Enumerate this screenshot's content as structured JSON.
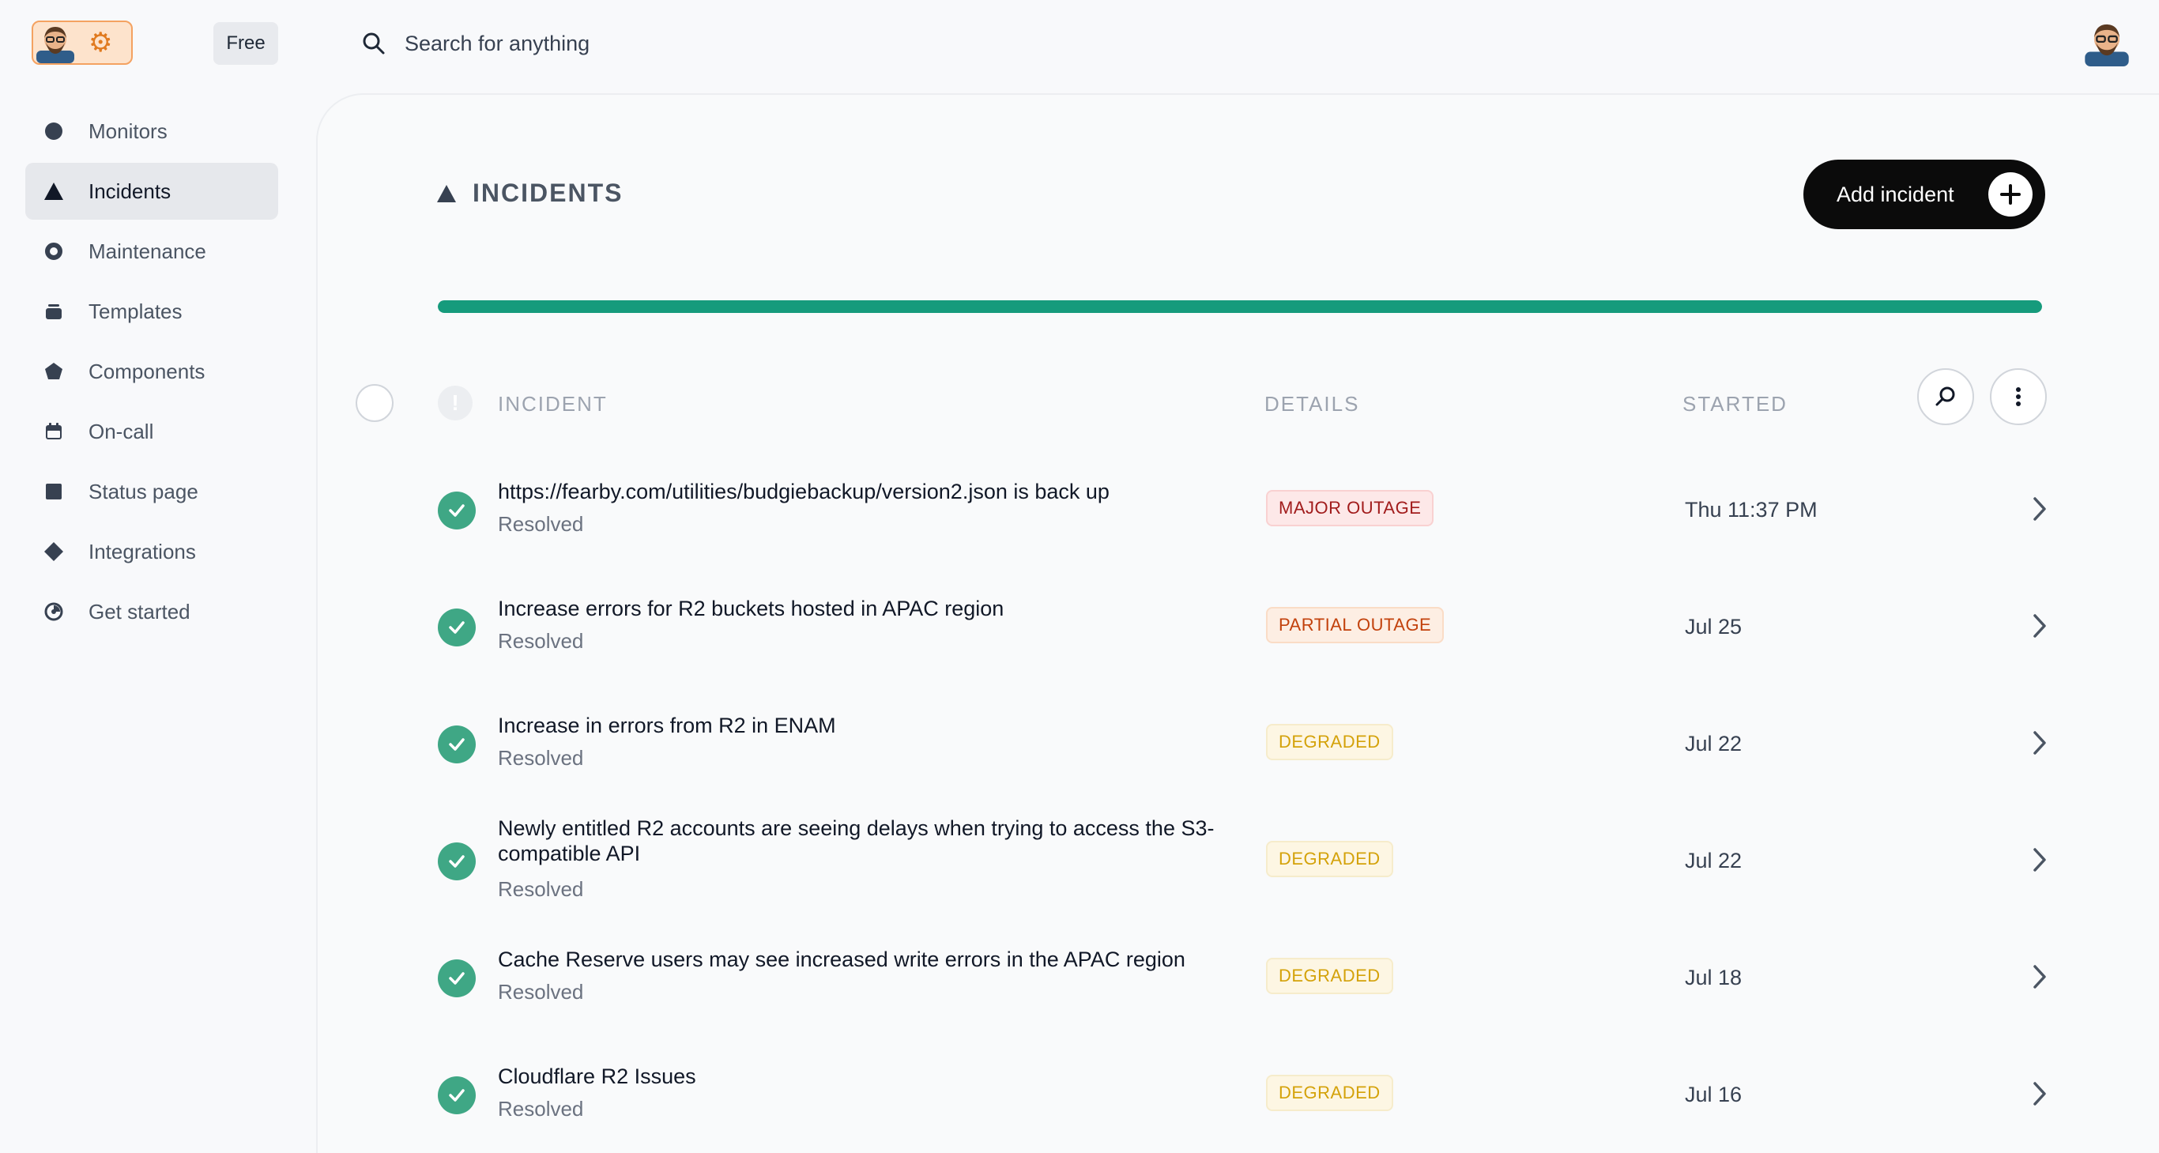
{
  "app": {
    "plan_badge": "Free"
  },
  "search": {
    "placeholder": "Search for anything"
  },
  "sidebar": {
    "items": [
      {
        "label": "Monitors",
        "icon": "circle-icon",
        "active": false
      },
      {
        "label": "Incidents",
        "icon": "triangle-icon",
        "active": true
      },
      {
        "label": "Maintenance",
        "icon": "ring-icon",
        "active": false
      },
      {
        "label": "Templates",
        "icon": "stack-icon",
        "active": false
      },
      {
        "label": "Components",
        "icon": "pentagon-icon",
        "active": false
      },
      {
        "label": "On-call",
        "icon": "calendar-icon",
        "active": false
      },
      {
        "label": "Status page",
        "icon": "square-icon",
        "active": false
      },
      {
        "label": "Integrations",
        "icon": "diamond-icon",
        "active": false
      },
      {
        "label": "Get started",
        "icon": "gauge-icon",
        "active": false
      }
    ]
  },
  "main": {
    "title": "INCIDENTS",
    "add_button_label": "Add incident",
    "progress_fraction": 1.0,
    "columns": {
      "incident": "INCIDENT",
      "details": "DETAILS",
      "started": "STARTED"
    },
    "rows": [
      {
        "title": "https://fearby.com/utilities/budgiebackup/version2.json is back up",
        "status": "Resolved",
        "badge": "MAJOR OUTAGE",
        "severity": "major",
        "started": "Thu 11:37 PM"
      },
      {
        "title": "Increase errors for R2 buckets hosted in APAC region",
        "status": "Resolved",
        "badge": "PARTIAL OUTAGE",
        "severity": "partial",
        "started": "Jul 25"
      },
      {
        "title": "Increase in errors from R2 in ENAM",
        "status": "Resolved",
        "badge": "DEGRADED",
        "severity": "degraded",
        "started": "Jul 22"
      },
      {
        "title": "Newly entitled R2 accounts are seeing delays when trying to access the S3-compatible API",
        "status": "Resolved",
        "badge": "DEGRADED",
        "severity": "degraded",
        "started": "Jul 22"
      },
      {
        "title": "Cache Reserve users may see increased write errors in the APAC region",
        "status": "Resolved",
        "badge": "DEGRADED",
        "severity": "degraded",
        "started": "Jul 18"
      },
      {
        "title": "Cloudflare R2 Issues",
        "status": "Resolved",
        "badge": "DEGRADED",
        "severity": "degraded",
        "started": "Jul 16"
      }
    ]
  },
  "colors": {
    "accent": "#169b7c",
    "resolved": "#3fa785",
    "major": "#a11c1c",
    "partial": "#c2410c",
    "degraded": "#d4a20a"
  }
}
